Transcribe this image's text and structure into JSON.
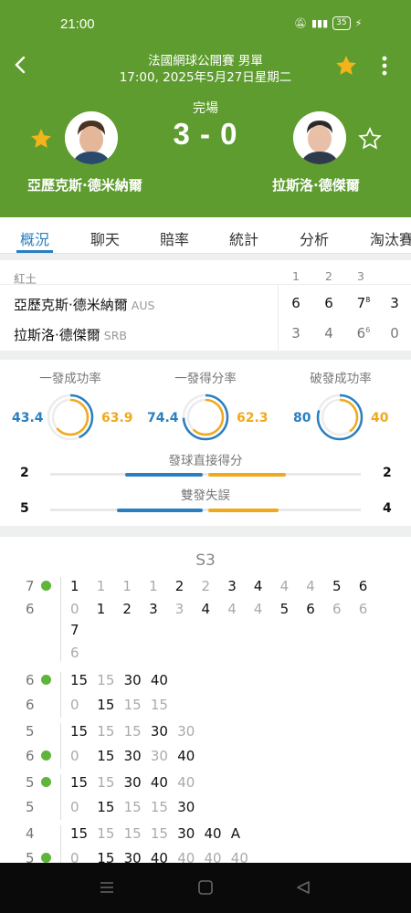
{
  "status_bar": {
    "time": "21:00",
    "battery": "35"
  },
  "header": {
    "tournament": "法國網球公開賽 男單",
    "datetime": "17:00, 2025年5月27日星期二",
    "match_status": "完場",
    "score": "3 - 0",
    "player1": "亞歷克斯·德米納爾",
    "player2": "拉斯洛·德傑爾"
  },
  "tabs": [
    "概況",
    "聊天",
    "賠率",
    "統計",
    "分析",
    "淘汰賽"
  ],
  "scoreboard": {
    "surface": "紅土",
    "set_headers": [
      "1",
      "2",
      "3"
    ],
    "rows": [
      {
        "name": "亞歷克斯·德米納爾",
        "country": "AUS",
        "s1": "6",
        "s2": "6",
        "s3": "7",
        "s3_tb": "8",
        "current": "3"
      },
      {
        "name": "拉斯洛·德傑爾",
        "country": "SRB",
        "s1": "3",
        "s2": "4",
        "s3": "6",
        "s3_tb": "6",
        "current": "0"
      }
    ]
  },
  "stats": {
    "labels": [
      "一發成功率",
      "一發得分率",
      "破發成功率"
    ],
    "values": [
      {
        "left": "43.4",
        "right": "63.9",
        "left_pct": 43.4,
        "right_pct": 63.9
      },
      {
        "left": "74.4",
        "right": "62.3",
        "left_pct": 74.4,
        "right_pct": 62.3
      },
      {
        "left": "80",
        "right": "40",
        "left_pct": 80,
        "right_pct": 40
      }
    ],
    "bars": [
      {
        "label": "發球直接得分",
        "left": "2",
        "right": "2",
        "left_frac": 0.5,
        "right_frac": 0.5
      },
      {
        "label": "雙發失誤",
        "left": "5",
        "right": "4",
        "left_frac": 0.55,
        "right_frac": 0.45
      }
    ],
    "colors": {
      "p1": "#2a7fc0",
      "p2": "#f0a91c"
    }
  },
  "pbp": {
    "title": "S3",
    "tiebreak_top": [
      "1",
      "1",
      "1",
      "1",
      "2",
      "2",
      "3",
      "4",
      "4",
      "4",
      "5",
      "6"
    ],
    "tiebreak_bottom": [
      "0",
      "1",
      "2",
      "3",
      "3",
      "4",
      "4",
      "4",
      "5",
      "6",
      "6",
      "6"
    ],
    "tiebreak_extra_top": "7",
    "tiebreak_extra_bottom": "6",
    "games": [
      {
        "score": "7",
        "opp": "6"
      },
      {
        "score": "6",
        "opp": "6"
      },
      {
        "score": "5",
        "opp": "6"
      },
      {
        "score": "5",
        "opp": "5"
      },
      {
        "score": "4",
        "opp": "5"
      }
    ],
    "points": [
      {
        "top": [
          "15",
          "15",
          "30",
          "40"
        ],
        "bottom": [
          "0",
          "15",
          "15",
          "15"
        ]
      },
      {
        "top": [
          "15",
          "15",
          "15",
          "30",
          "30"
        ],
        "bottom": [
          "0",
          "15",
          "30",
          "30",
          "40"
        ]
      },
      {
        "top": [
          "15",
          "15",
          "30",
          "40",
          "40"
        ],
        "bottom": [
          "0",
          "15",
          "15",
          "15",
          "30"
        ]
      },
      {
        "top": [
          "15",
          "15",
          "15",
          "15",
          "30",
          "40",
          "A"
        ],
        "bottom": [
          "0",
          "15",
          "30",
          "40",
          "40",
          "40",
          "40"
        ]
      }
    ]
  }
}
